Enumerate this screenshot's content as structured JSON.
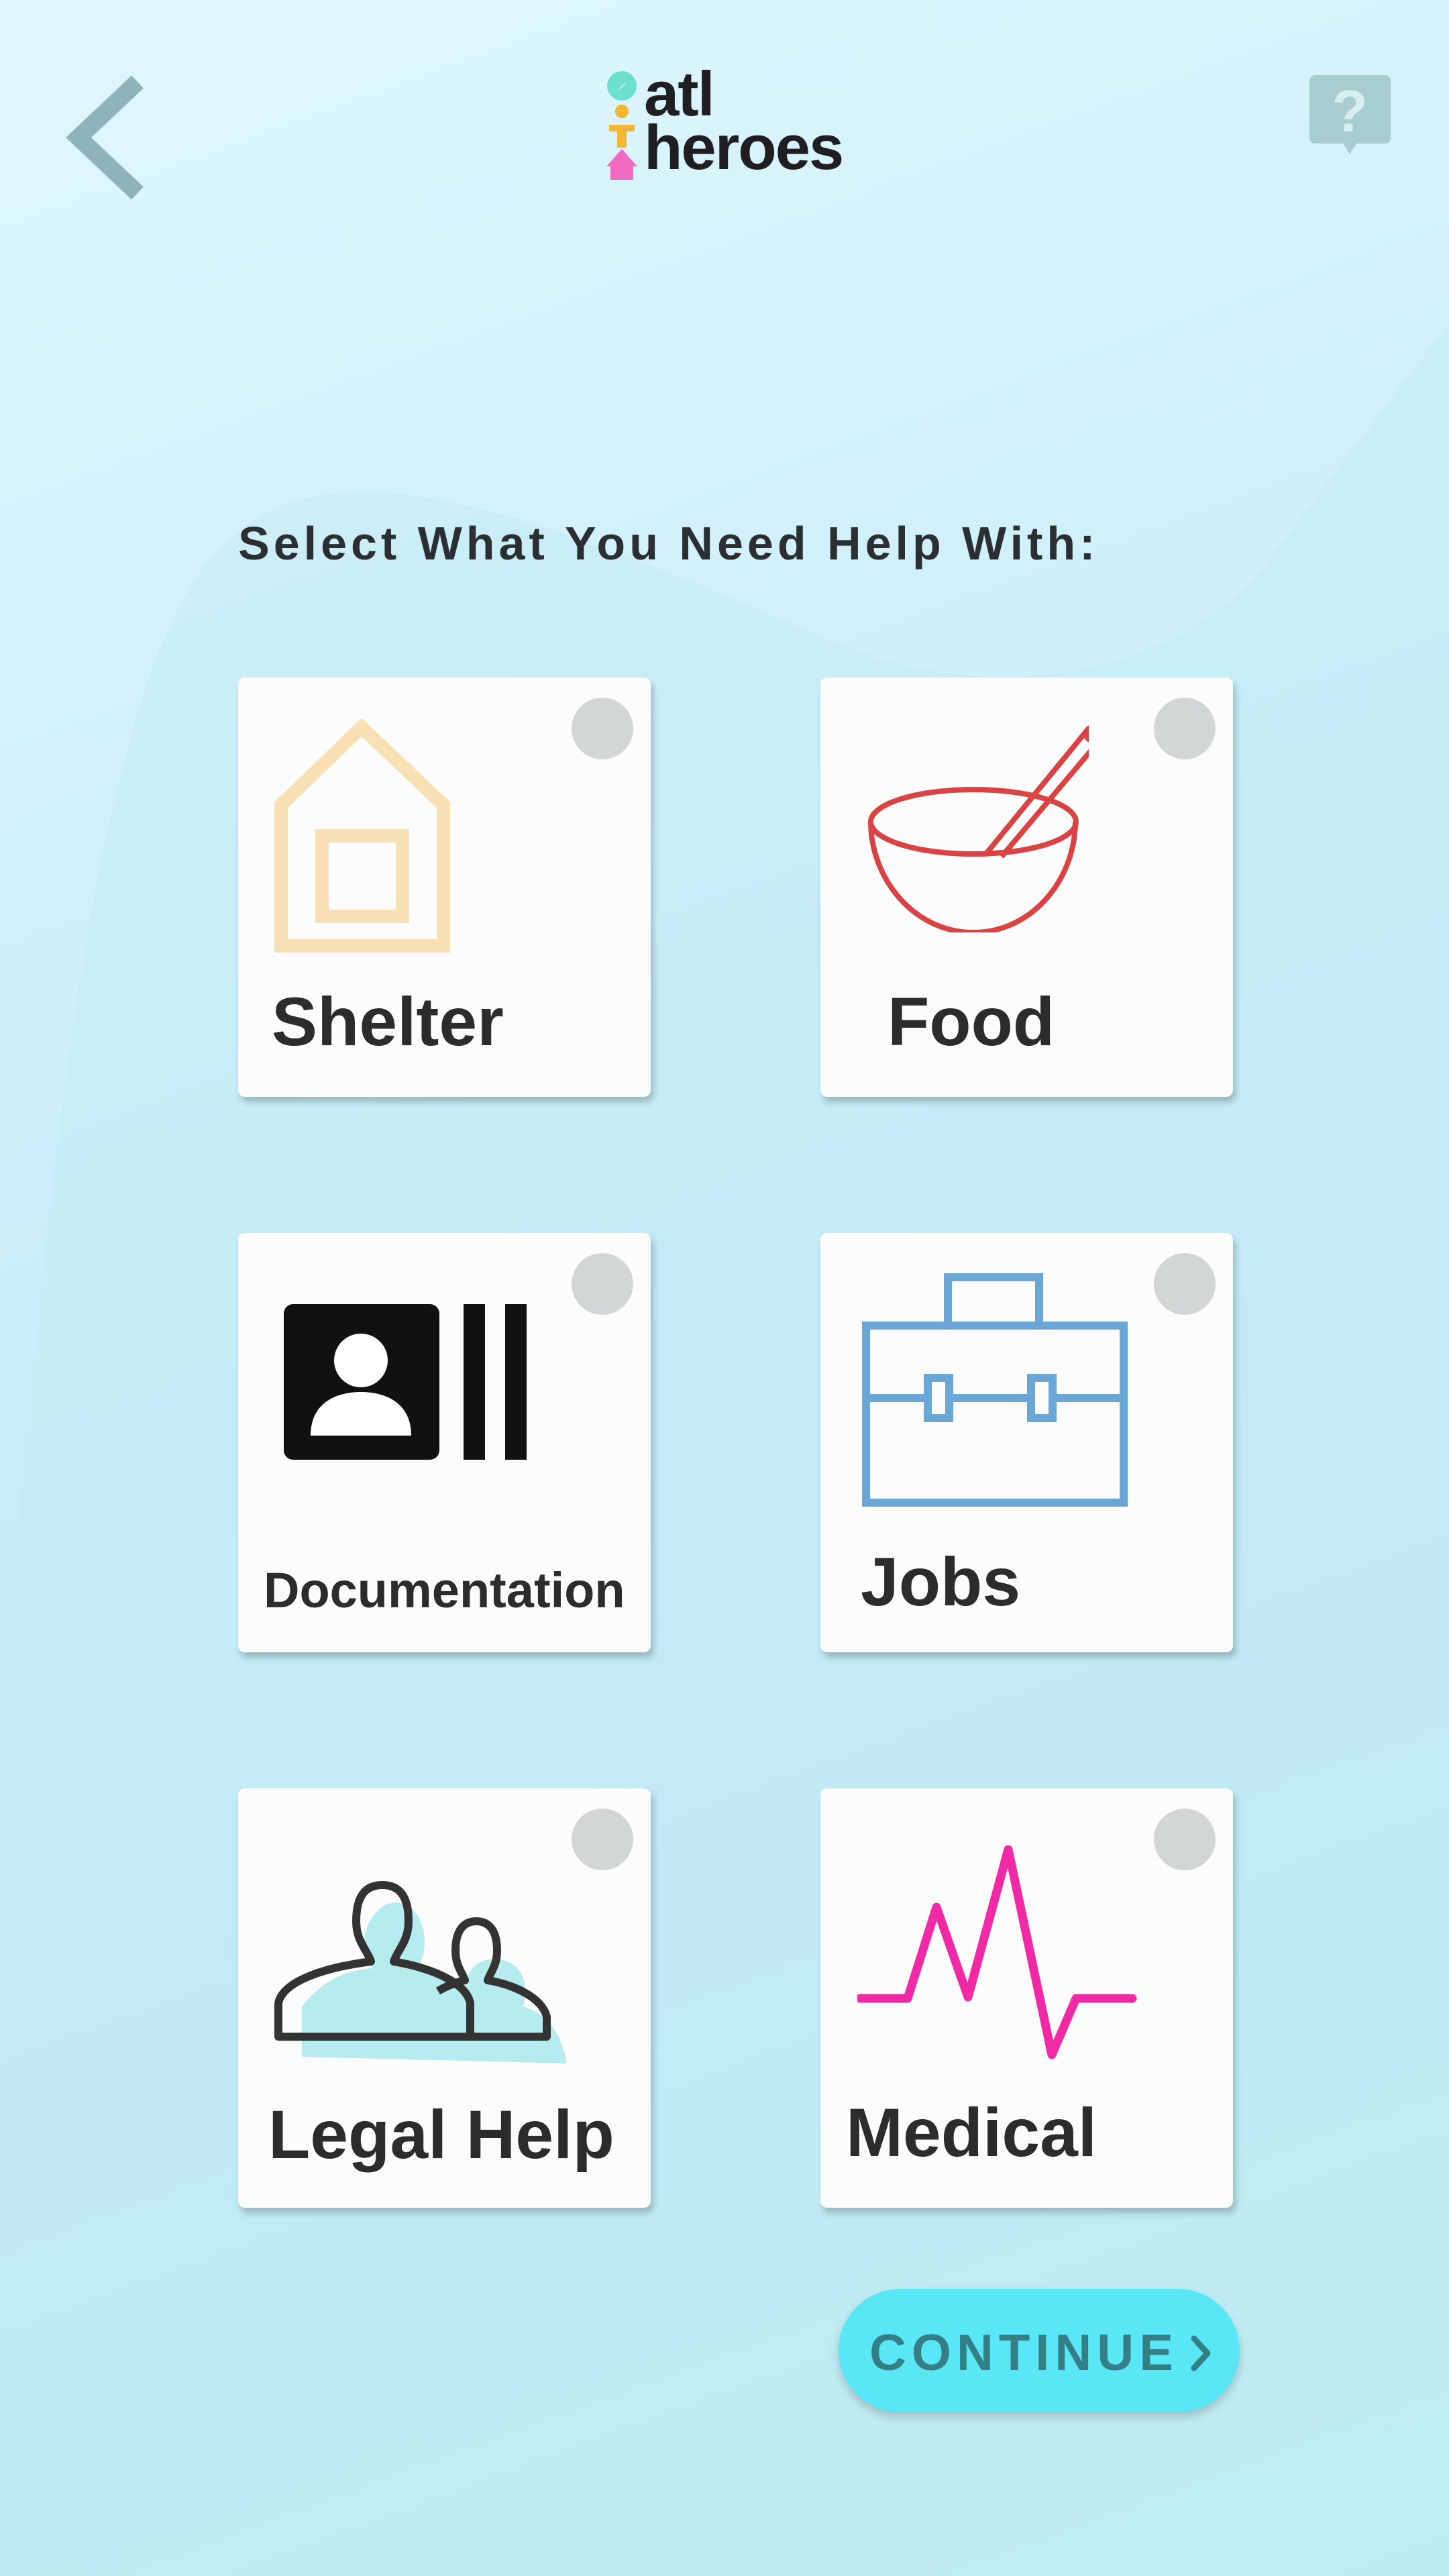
{
  "header": {
    "back_icon": "chevron-left-icon",
    "help_icon": "help-question-icon",
    "logo": {
      "line1": "atl",
      "line2": "heroes"
    }
  },
  "prompt": "Select What You Need Help With:",
  "options": [
    {
      "label": "Shelter",
      "icon": "house-icon",
      "icon_color": "#f8e0b4",
      "selected": false
    },
    {
      "label": "Food",
      "icon": "bowl-spoon-icon",
      "icon_color": "#d94343",
      "selected": false
    },
    {
      "label": "Documentation",
      "icon": "id-card-icon",
      "icon_color": "#111111",
      "selected": false
    },
    {
      "label": "Jobs",
      "icon": "briefcase-icon",
      "icon_color": "#6aa6d6",
      "selected": false
    },
    {
      "label": "Legal Help",
      "icon": "people-icon",
      "icon_color": "#333333",
      "selected": false
    },
    {
      "label": "Medical",
      "icon": "heartbeat-icon",
      "icon_color": "#ef2aa4",
      "selected": false
    }
  ],
  "continue_button": {
    "label": "CONTINUE",
    "icon": "chevron-right-icon"
  },
  "colors": {
    "accent": "#5ae7f5",
    "button_text": "#347f86",
    "radio": "#d3d6d6",
    "text": "#2c2c2c"
  }
}
